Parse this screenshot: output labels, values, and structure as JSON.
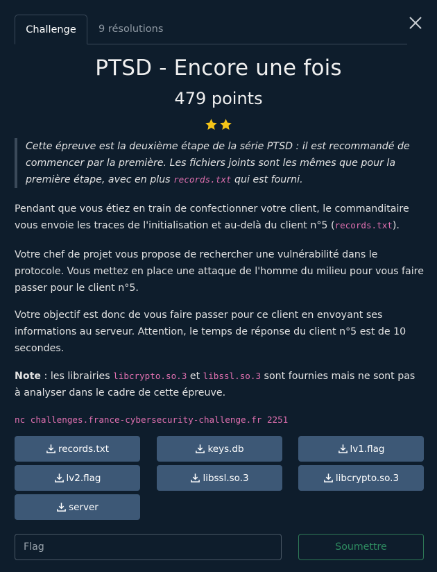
{
  "tabs": {
    "challenge": "Challenge",
    "resolutions": "9 résolutions"
  },
  "challenge": {
    "title": "PTSD - Encore une fois",
    "points": "479 points",
    "stars": 2
  },
  "quote": {
    "text": "Cette épreuve est la deuxième étape de la série PTSD : il est recommandé de commencer par la première. Les fichiers joints sont les mêmes que pour la première étape, avec en plus ",
    "code": "records.txt",
    "tail": " qui est fourni."
  },
  "para1": {
    "text": "Pendant que vous étiez en train de confectionner votre client, le commanditaire vous envoie les traces de l'initialisation et au-delà du client n°5 (",
    "code": "records.txt",
    "tail": ")."
  },
  "para2": "Votre chef de projet vous propose de rechercher une vulnérabilité dans le protocole. Vous mettez en place une attaque de l'homme du milieu pour vous faire passer pour le client n°5.",
  "para3": "Votre objectif est donc de vous faire passer pour ce client en envoyant ses informations au serveur. Attention, le temps de réponse du client n°5 est de 10 secondes.",
  "note": {
    "label": "Note",
    "text1": " : les librairies ",
    "code1": "libcrypto.so.3",
    "text2": " et ",
    "code2": "libssl.so.3",
    "text3": " sont fournies mais ne sont pas à analyser dans le cadre de cette épreuve."
  },
  "command": "nc challenges.france-cybersecurity-challenge.fr 2251",
  "files": [
    "records.txt",
    "keys.db",
    "lv1.flag",
    "lv2.flag",
    "libssl.so.3",
    "libcrypto.so.3",
    "server"
  ],
  "flag_input": {
    "placeholder": "Flag",
    "value": ""
  },
  "submit_label": "Soumettre",
  "colors": {
    "background": "#0e1d2c",
    "button": "#3d5876",
    "code": "#e070b0",
    "star": "#f5c518",
    "submit": "#2e8b60"
  },
  "icons": {
    "close": "close-icon",
    "star": "star-icon",
    "download": "download-icon"
  }
}
